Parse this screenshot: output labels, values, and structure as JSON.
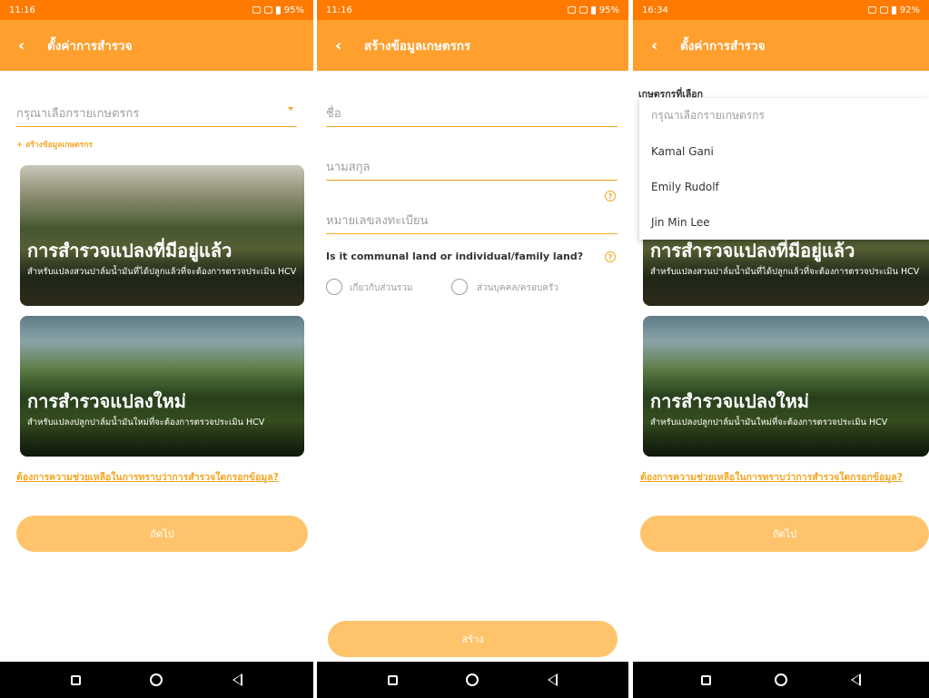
{
  "screen1": {
    "status": {
      "time": "11:16",
      "battery": "95%"
    },
    "title": "ตั้งค่าการสำรวจ",
    "farmer_select": {
      "placeholder": "กรุณาเลือกรายเกษตรกร"
    },
    "add_farmer_link": "+ สร้างข้อมูลเกษตรกร",
    "card_existing": {
      "title": "การสำรวจแปลงที่มีอยู่แล้ว",
      "subtitle": "สำหรับแปลงสวนปาล์มน้ำมันที่ได้ปลูกแล้วที่จะต้องการตรวจประเมิน HCV"
    },
    "card_new": {
      "title": "การสำรวจแปลงใหม่",
      "subtitle": "สำหรับแปลงปลูกปาล์มน้ำมันใหม่ที่จะต้องการตรวจประเมิน HCV"
    },
    "help_link": "ต้องการความช่วยเหลือในการทราบว่าการสำรวจใดกรอกข้อมูล?",
    "next_button": "ถัดไป"
  },
  "screen2": {
    "status": {
      "time": "11:16",
      "battery": "95%"
    },
    "title": "สร้างข้อมูลเกษตรกร",
    "first_name": {
      "placeholder": "ชื่อ"
    },
    "last_name": {
      "placeholder": "นามสกุล"
    },
    "registration_no": {
      "placeholder": "หมายเลขลงทะเบียน"
    },
    "land_question": "Is it communal land or individual/family land?",
    "option_communal": "เกี่ยวกับส่วนรวม",
    "option_individual": "ส่วนบุคคล/ครอบครัว",
    "create_button": "สร้าง"
  },
  "screen3": {
    "status": {
      "time": "16:34",
      "battery": "92%"
    },
    "title": "ตั้งค่าการสำรวจ",
    "selected_label": "เกษตรกรที่เลือก",
    "dropdown": {
      "placeholder": "กรุณาเลือกรายเกษตรกร",
      "options": [
        "Kamal Gani",
        "Emily Rudolf",
        "Jin Min Lee"
      ]
    },
    "card_existing": {
      "title": "การสำรวจแปลงที่มีอยู่แล้ว",
      "subtitle": "สำหรับแปลงสวนปาล์มน้ำมันที่ได้ปลูกแล้วที่จะต้องการตรวจประเมิน HCV"
    },
    "card_new": {
      "title": "การสำรวจแปลงใหม่",
      "subtitle": "สำหรับแปลงปลูกปาล์มน้ำมันใหม่ที่จะต้องการตรวจประเมิน HCV"
    },
    "help_link": "ต้องการความช่วยเหลือในการทราบว่าการสำรวจใดกรอกข้อมูล?",
    "next_button": "ถัดไป"
  },
  "colors": {
    "statusbar": "#ff7a00",
    "appbar": "#ff9f2e",
    "accent": "#f5a623",
    "button": "#ffc46b"
  },
  "icons": {
    "back": "chevron-left-icon",
    "help": "question-circle-icon",
    "nav_recents": "square-icon",
    "nav_home": "circle-icon",
    "nav_back": "triangle-back-icon"
  }
}
